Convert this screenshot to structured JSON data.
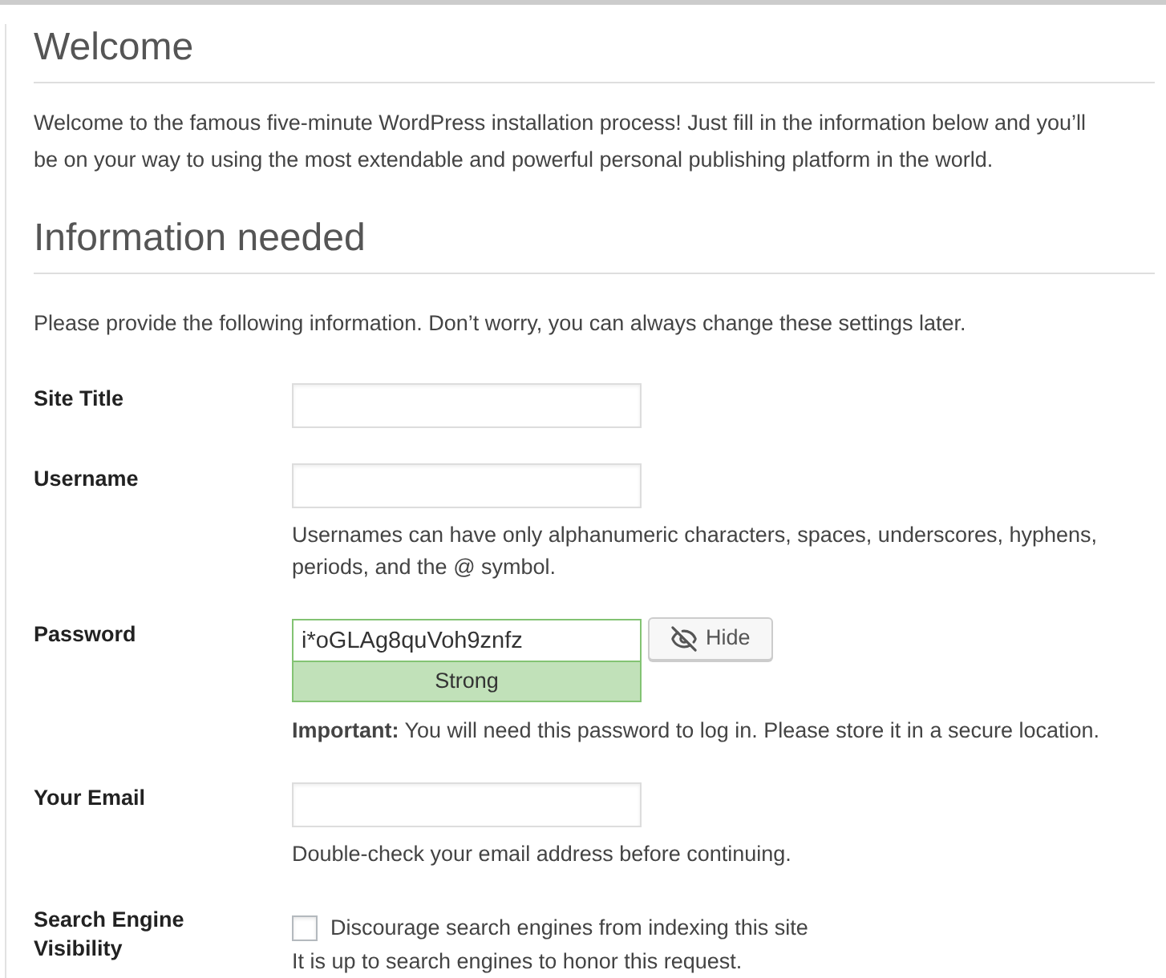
{
  "welcome": {
    "heading": "Welcome",
    "intro": "Welcome to the famous five-minute WordPress installation process! Just fill in the information below and you’ll be on your way to using the most extendable and powerful personal publishing platform in the world."
  },
  "info": {
    "heading": "Information needed",
    "intro": "Please provide the following information. Don’t worry, you can always change these settings later."
  },
  "fields": [
    {
      "kind": "text",
      "label": "Site Title"
    },
    {
      "kind": "text",
      "label": "Username",
      "help": "Usernames can have only alphanumeric characters, spaces, underscores, hyphens, periods, and the @ symbol."
    },
    {
      "kind": "password",
      "label": "Password",
      "value": "i*oGLAg8quVoh9znfz",
      "strength": "Strong",
      "toggle": "Hide",
      "help": "**Important:** You will need this password to log in. Please store it in a secure location."
    },
    {
      "kind": "text",
      "label": "Your Email",
      "help": "Double-check your email address before continuing."
    },
    {
      "kind": "checkbox",
      "label": "Search Engine Visibility",
      "option": "Discourage search engines from indexing this site",
      "checked": false,
      "help": "It is up to search engines to honor this request."
    }
  ]
}
